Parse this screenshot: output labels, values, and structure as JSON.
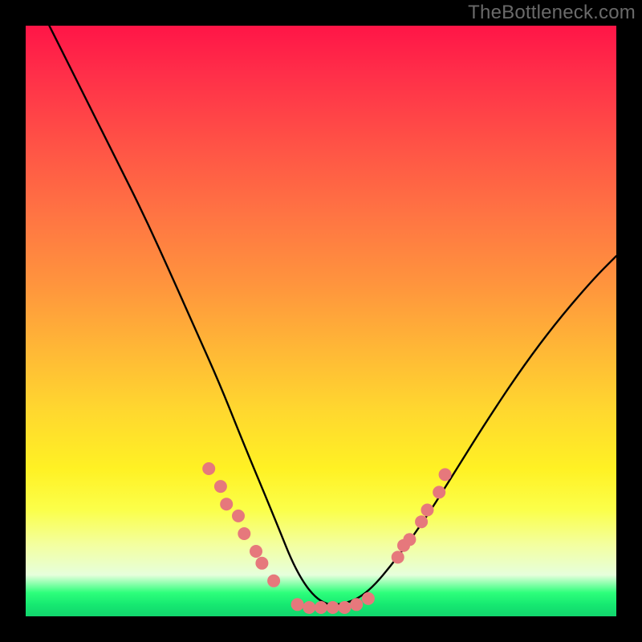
{
  "watermark": "TheBottleneck.com",
  "chart_data": {
    "type": "line",
    "title": "",
    "xlabel": "",
    "ylabel": "",
    "xlim": [
      0,
      100
    ],
    "ylim": [
      0,
      100
    ],
    "grid": false,
    "legend": false,
    "note": "Axes and scale are not labeled in the image; values are estimated as percentages of the plotting area (origin bottom-left, larger y = higher on screen).",
    "series": [
      {
        "name": "curve",
        "x": [
          4,
          6,
          10,
          15,
          20,
          25,
          29,
          33,
          37,
          42,
          46,
          50,
          54,
          58,
          63,
          68,
          73,
          78,
          84,
          90,
          96,
          100
        ],
        "y": [
          100,
          96,
          88,
          78,
          68,
          57,
          48,
          39,
          29,
          17,
          7,
          2,
          2,
          4,
          10,
          17,
          25,
          33,
          42,
          50,
          57,
          61
        ]
      }
    ],
    "points": [
      {
        "name": "left-cluster",
        "x": [
          31,
          33,
          34,
          36,
          37,
          39,
          40,
          42
        ],
        "y": [
          25,
          22,
          19,
          17,
          14,
          11,
          9,
          6
        ]
      },
      {
        "name": "bottom-cluster",
        "x": [
          46,
          48,
          50,
          52,
          54,
          56,
          58
        ],
        "y": [
          2,
          1.5,
          1.5,
          1.5,
          1.5,
          2,
          3
        ]
      },
      {
        "name": "right-cluster",
        "x": [
          63,
          64,
          65,
          67,
          68,
          70,
          71
        ],
        "y": [
          10,
          12,
          13,
          16,
          18,
          21,
          24
        ]
      }
    ],
    "point_color": "#e6787c",
    "curve_color": "#000000"
  }
}
